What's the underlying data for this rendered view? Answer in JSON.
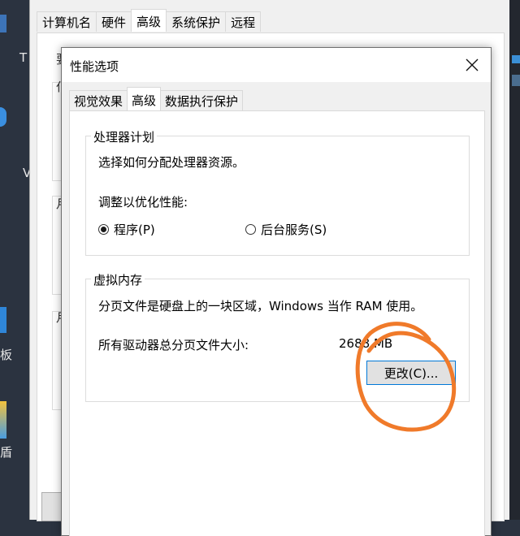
{
  "desktop": {
    "edge_labels": [
      "T",
      "V",
      "板",
      "盾"
    ]
  },
  "system_properties": {
    "tabs": [
      "计算机名",
      "硬件",
      "高级",
      "系统保护",
      "远程"
    ],
    "active_tab": "高级",
    "edge_chars": [
      "要",
      "仆",
      "月",
      "月"
    ]
  },
  "dialog": {
    "title": "性能选项",
    "close_icon": "close-icon",
    "tabs": [
      "视觉效果",
      "高级",
      "数据执行保护"
    ],
    "active_tab": "高级",
    "processor": {
      "title": "处理器计划",
      "description": "选择如何分配处理器资源。",
      "adjust_label": "调整以优化性能:",
      "option_programs": "程序(P)",
      "option_background": "后台服务(S)",
      "selected": "程序(P)"
    },
    "virtual_memory": {
      "title": "虚拟内存",
      "description": "分页文件是硬盘上的一块区域，Windows 当作 RAM 使用。",
      "total_label": "所有驱动器总分页文件大小:",
      "total_value": "2688 MB",
      "change_button": "更改(C)..."
    }
  },
  "annotation": {
    "shape": "hand-drawn circle",
    "color": "#f07a2a"
  }
}
